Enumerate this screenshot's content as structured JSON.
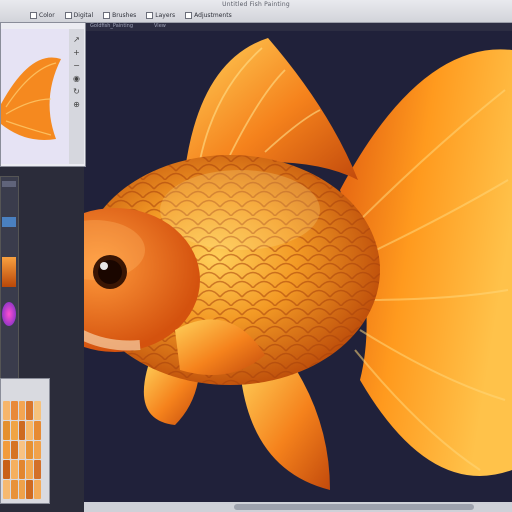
{
  "app": {
    "title": "Untitled Fish Painting"
  },
  "menu": {
    "items": [
      {
        "label": "Color"
      },
      {
        "label": "Digital"
      },
      {
        "label": "Brushes"
      },
      {
        "label": "Layers"
      },
      {
        "label": "Adjustments"
      }
    ]
  },
  "document": {
    "tab_label": "Goldfish_Painting",
    "tab_secondary": "View"
  },
  "navigator": {
    "tools": [
      "↗",
      "+",
      "−",
      "◉",
      "↻",
      "⊕"
    ]
  },
  "colors": {
    "canvas_background": "#20213a",
    "accent_orange": "#f07a12",
    "fin_orange": "#ff9a1e",
    "panel_bg": "#ececf2"
  },
  "swatches": [
    "#f6b56b",
    "#e8893a",
    "#f4a552",
    "#d9772d",
    "#f6c27d",
    "#e4902f",
    "#f0a444",
    "#cd6a20",
    "#f7b768",
    "#e68a34",
    "#f29b3c",
    "#d67323",
    "#f8c384",
    "#e79235",
    "#f1a24c",
    "#c96018",
    "#f5b05f",
    "#e2862f",
    "#f3a850",
    "#d3702a",
    "#f6b96f",
    "#e8923a",
    "#efa14a",
    "#cf6b21",
    "#f4ab58"
  ]
}
